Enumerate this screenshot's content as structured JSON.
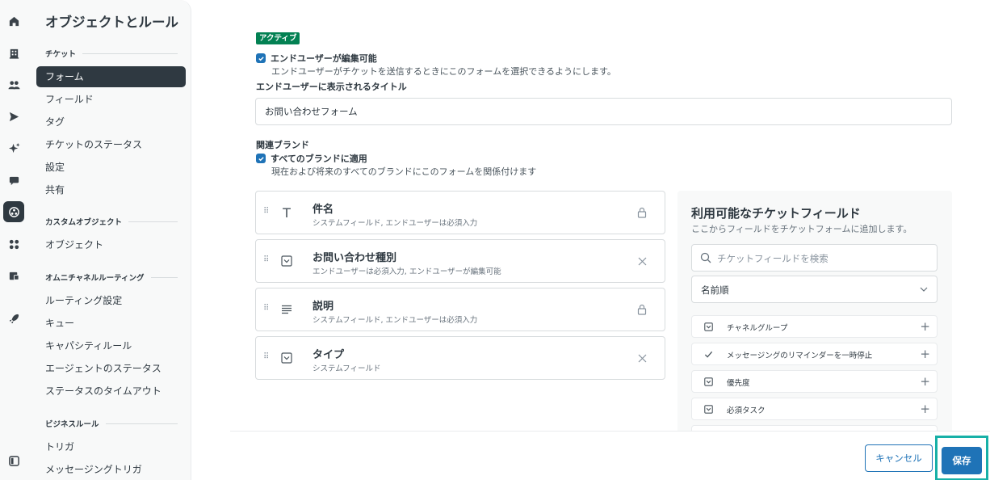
{
  "rail": {
    "icons": [
      "home-icon",
      "building-icon",
      "users-icon",
      "send-icon",
      "sparkle-icon",
      "chat-icon",
      "objects-icon",
      "apps-icon",
      "workspace-icon",
      "rocket-icon",
      "panel-toggle-icon"
    ]
  },
  "subnav": {
    "title": "オブジェクトとルール",
    "sections": {
      "ticket": "チケット",
      "custom": "カスタムオブジェクト",
      "omni": "オムニチャネルルーティング",
      "business": "ビジネスルール"
    },
    "items": {
      "form": "フォーム",
      "fields": "フィールド",
      "tags": "タグ",
      "ticket_status": "チケットのステータス",
      "settings": "設定",
      "sharing": "共有",
      "objects": "オブジェクト",
      "routing_settings": "ルーティング設定",
      "queues": "キュー",
      "capacity_rules": "キャパシティルール",
      "agent_status": "エージェントのステータス",
      "status_timeout": "ステータスのタイムアウト",
      "triggers": "トリガ",
      "messaging_triggers": "メッセージングトリガ"
    }
  },
  "form": {
    "badge": "アクティブ",
    "editable_label": "エンドユーザーが編集可能",
    "editable_hint": "エンドユーザーがチケットを送信するときにこのフォームを選択できるようにします。",
    "title_label": "エンドユーザーに表示されるタイトル",
    "title_value": "お問い合わせフォーム",
    "brand_label": "関連ブランド",
    "all_brands_label": "すべてのブランドに適用",
    "all_brands_hint": "現在および将来のすべてのブランドにこのフォームを関係付けます",
    "fields": [
      {
        "title": "件名",
        "sub": "システムフィールド, エンドユーザーは必須入力",
        "icon": "text-icon",
        "action": "lock-icon"
      },
      {
        "title": "お問い合わせ種別",
        "sub": "エンドユーザーは必須入力, エンドユーザーが編集可能",
        "icon": "dropdown-icon",
        "action": "remove-icon"
      },
      {
        "title": "説明",
        "sub": "システムフィールド, エンドユーザーは必須入力",
        "icon": "paragraph-icon",
        "action": "lock-icon"
      },
      {
        "title": "タイプ",
        "sub": "システムフィールド",
        "icon": "dropdown-icon",
        "action": "remove-icon"
      }
    ]
  },
  "available": {
    "title": "利用可能なチケットフィールド",
    "subtitle": "ここからフィールドをチケットフォームに追加します。",
    "search_placeholder": "チケットフィールドを検索",
    "sort_value": "名前順",
    "items": [
      {
        "label": "チャネルグループ",
        "icon": "dropdown-icon"
      },
      {
        "label": "メッセージングのリマインダーを一時停止",
        "icon": "check-icon"
      },
      {
        "label": "優先度",
        "icon": "dropdown-icon"
      },
      {
        "label": "必須タスク",
        "icon": "dropdown-icon"
      }
    ]
  },
  "footer": {
    "cancel_label": "キャンセル",
    "save_label": "保存"
  },
  "colors": {
    "accent": "#1f73b7",
    "active_badge": "#038153",
    "highlight": "#17b0a7",
    "nav_active": "#2f3941"
  }
}
